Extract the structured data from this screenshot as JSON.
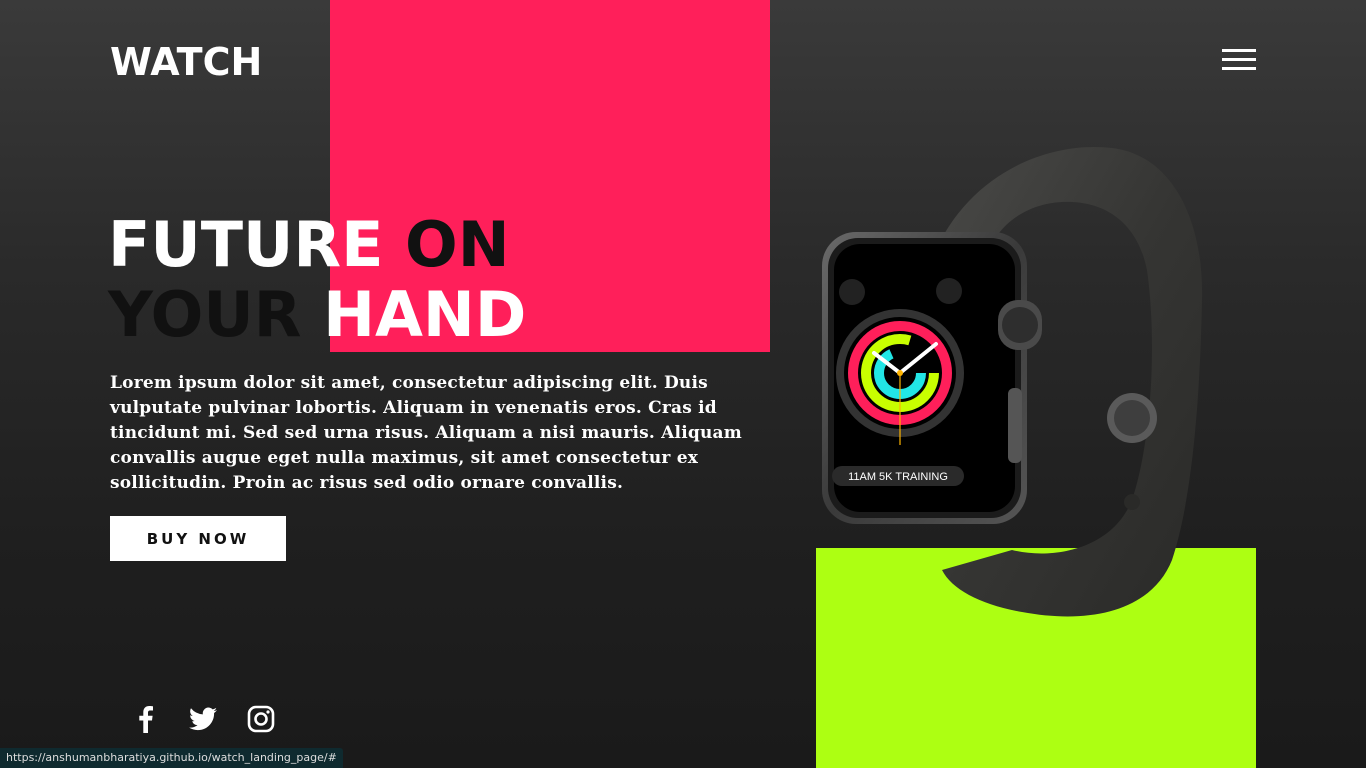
{
  "header": {
    "logo": "WATCH"
  },
  "hero": {
    "line1_white": "FUTURE ",
    "line1_dark": "ON",
    "line2_dark": "YOUR ",
    "line2_white": "HAND",
    "description": "Lorem ipsum dolor sit amet, consectetur adipiscing elit. Duis vulputate pulvinar lobortis. Aliquam in venenatis eros. Cras id tincidunt mi. Sed sed urna risus. Aliquam a nisi mauris. Aliquam convallis augue eget nulla maximus, sit amet consectetur ex sollicitudin. Proin ac risus sed odio ornare convallis.",
    "cta_label": "BUY NOW"
  },
  "watch_screen": {
    "training_label": "11AM 5K TRAINING"
  },
  "socials": [
    {
      "icon": "facebook-icon"
    },
    {
      "icon": "twitter-icon"
    },
    {
      "icon": "instagram-icon"
    }
  ],
  "status_bar": {
    "url": "https://anshumanbharatiya.github.io/watch_landing_page/#"
  },
  "colors": {
    "pink": "#ff1f5a",
    "lime": "#adff12",
    "background": "#2a2a2a"
  }
}
